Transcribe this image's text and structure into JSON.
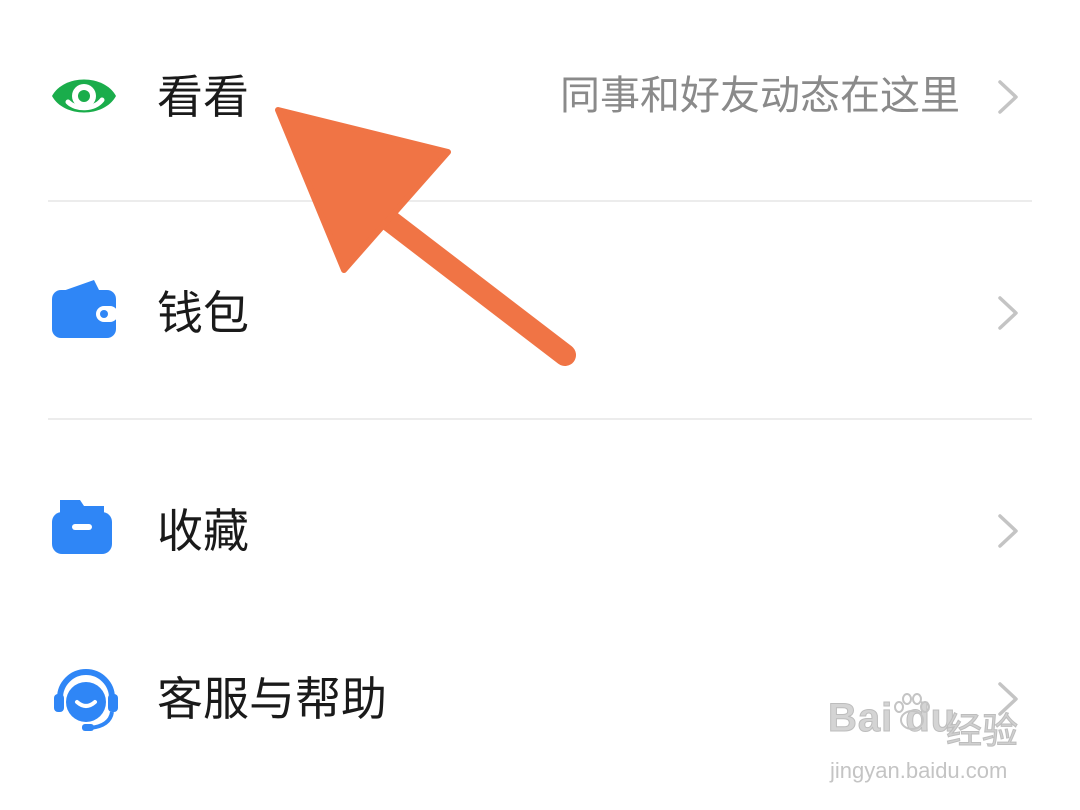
{
  "menu": {
    "items": [
      {
        "id": "kankan",
        "label": "看看",
        "description": "同事和好友动态在这里",
        "icon": "eye-icon",
        "icon_color": "#1aad4b"
      },
      {
        "id": "wallet",
        "label": "钱包",
        "description": "",
        "icon": "wallet-icon",
        "icon_color": "#2f86f6"
      },
      {
        "id": "favorites",
        "label": "收藏",
        "description": "",
        "icon": "folder-icon",
        "icon_color": "#2f86f6"
      },
      {
        "id": "help",
        "label": "客服与帮助",
        "description": "",
        "icon": "headset-icon",
        "icon_color": "#2f86f6"
      }
    ]
  },
  "annotation": {
    "arrow_color": "#f07445"
  },
  "watermark": {
    "brand": "Bai du",
    "cn": "经验",
    "url": "jingyan.baidu.com"
  }
}
